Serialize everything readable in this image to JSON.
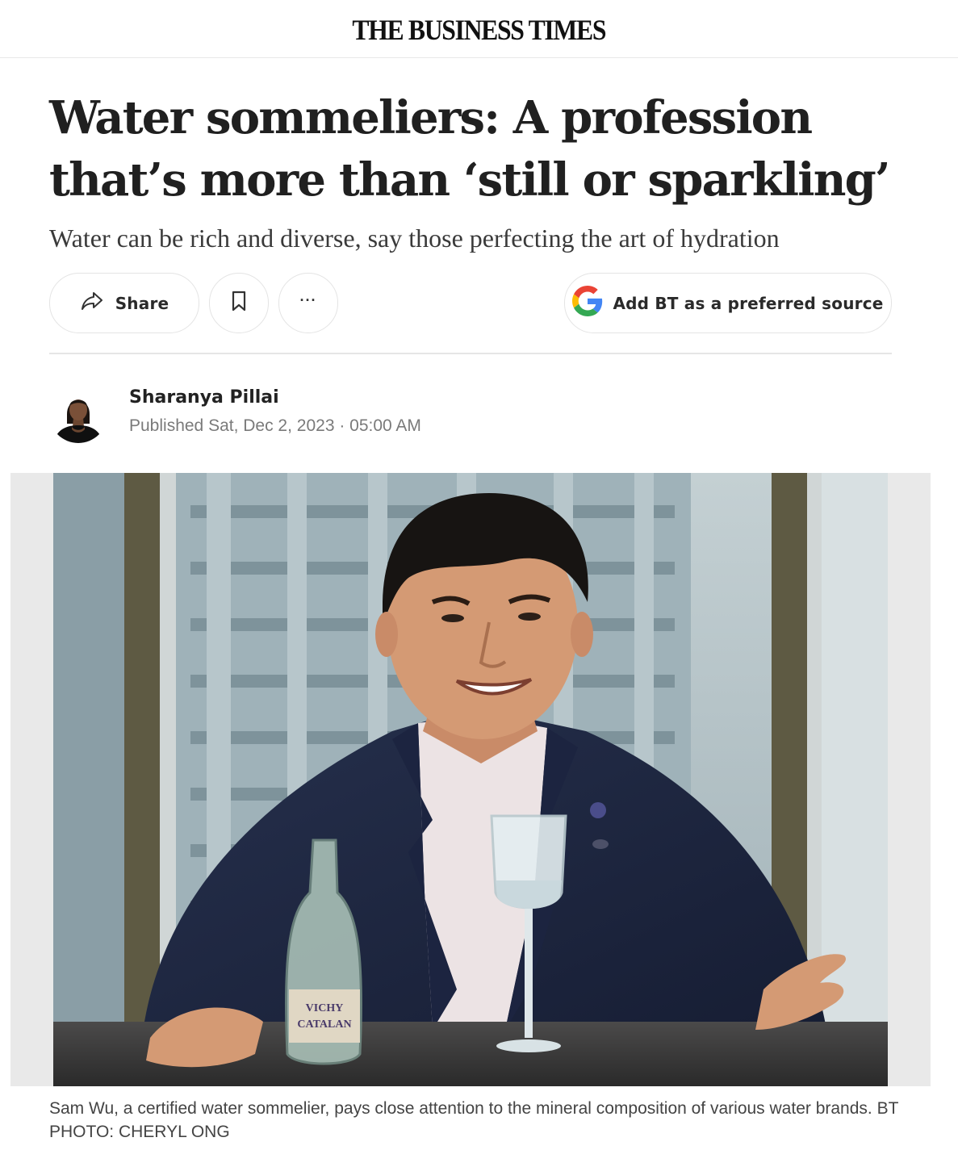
{
  "masthead": {
    "logo_text": "THE BUSINESS TIMES"
  },
  "article": {
    "headline": "Water sommeliers: A profession that’s more than ‘still or sparkling’",
    "subheadline": "Water can be rich and diverse, say those perfecting the art of hydration"
  },
  "actions": {
    "share_label": "Share",
    "bookmark_icon": "bookmark-icon",
    "more_label": "···",
    "source_label": "Add BT as a preferred source",
    "source_icon": "google-g-icon"
  },
  "byline": {
    "author": "Sharanya Pillai",
    "published": "Published Sat, Dec 2, 2023 · 05:00 AM"
  },
  "image": {
    "caption": "Sam Wu, a certified water sommelier, pays close attention to the mineral composition of various water brands. BT PHOTO: CHERYL ONG",
    "bottle_label_line1": "VICHY",
    "bottle_label_line2": "CATALAN"
  },
  "colors": {
    "google_blue": "#4285F4",
    "google_red": "#EA4335",
    "google_yellow": "#FBBC05",
    "google_green": "#34A853",
    "suit": "#1f2a44",
    "shirt": "#ece3e4"
  }
}
